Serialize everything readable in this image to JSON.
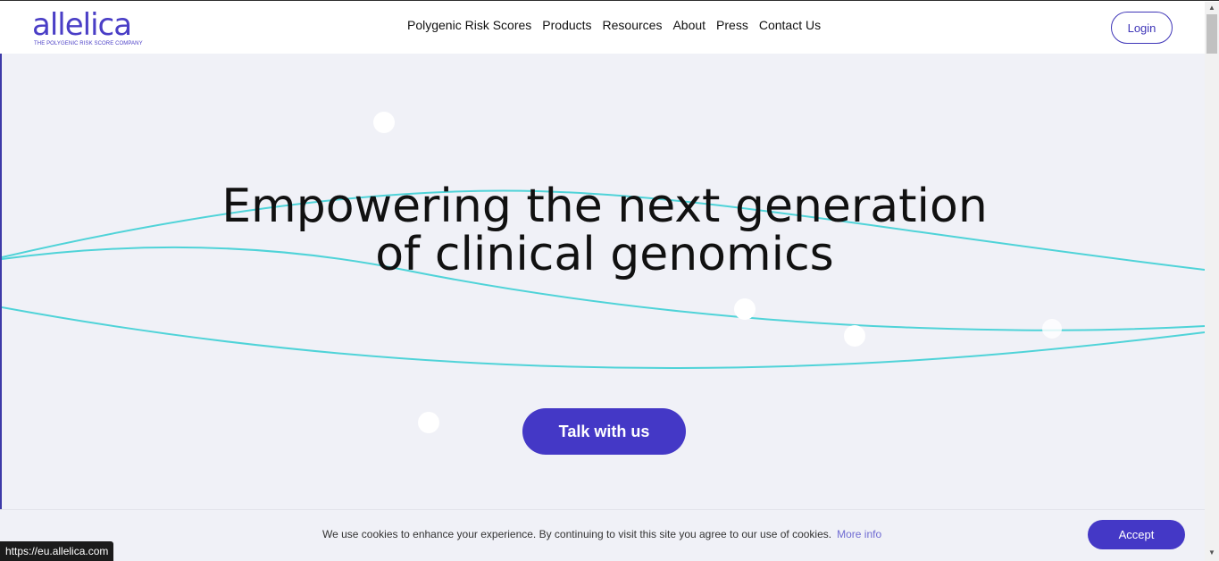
{
  "header": {
    "logo_text": "allelica",
    "logo_tagline": "THE POLYGENIC RISK SCORE COMPANY",
    "nav": [
      {
        "label": "Polygenic Risk Scores"
      },
      {
        "label": "Products"
      },
      {
        "label": "Resources"
      },
      {
        "label": "About"
      },
      {
        "label": "Press"
      },
      {
        "label": "Contact Us"
      }
    ],
    "login_label": "Login"
  },
  "hero": {
    "headline_line1": "Empowering the next generation",
    "headline_line2": "of clinical genomics",
    "cta_label": "Talk with us"
  },
  "cookie_bar": {
    "message": "We use cookies to enhance your experience. By continuing to visit this site you agree to our use of cookies.",
    "more_info": "More info",
    "accept_label": "Accept"
  },
  "status_bar": {
    "url": "https://eu.allelica.com"
  },
  "colors": {
    "brand": "#4438c6",
    "wave": "#4fd3d8",
    "hero_bg": "#f0f1f7"
  }
}
